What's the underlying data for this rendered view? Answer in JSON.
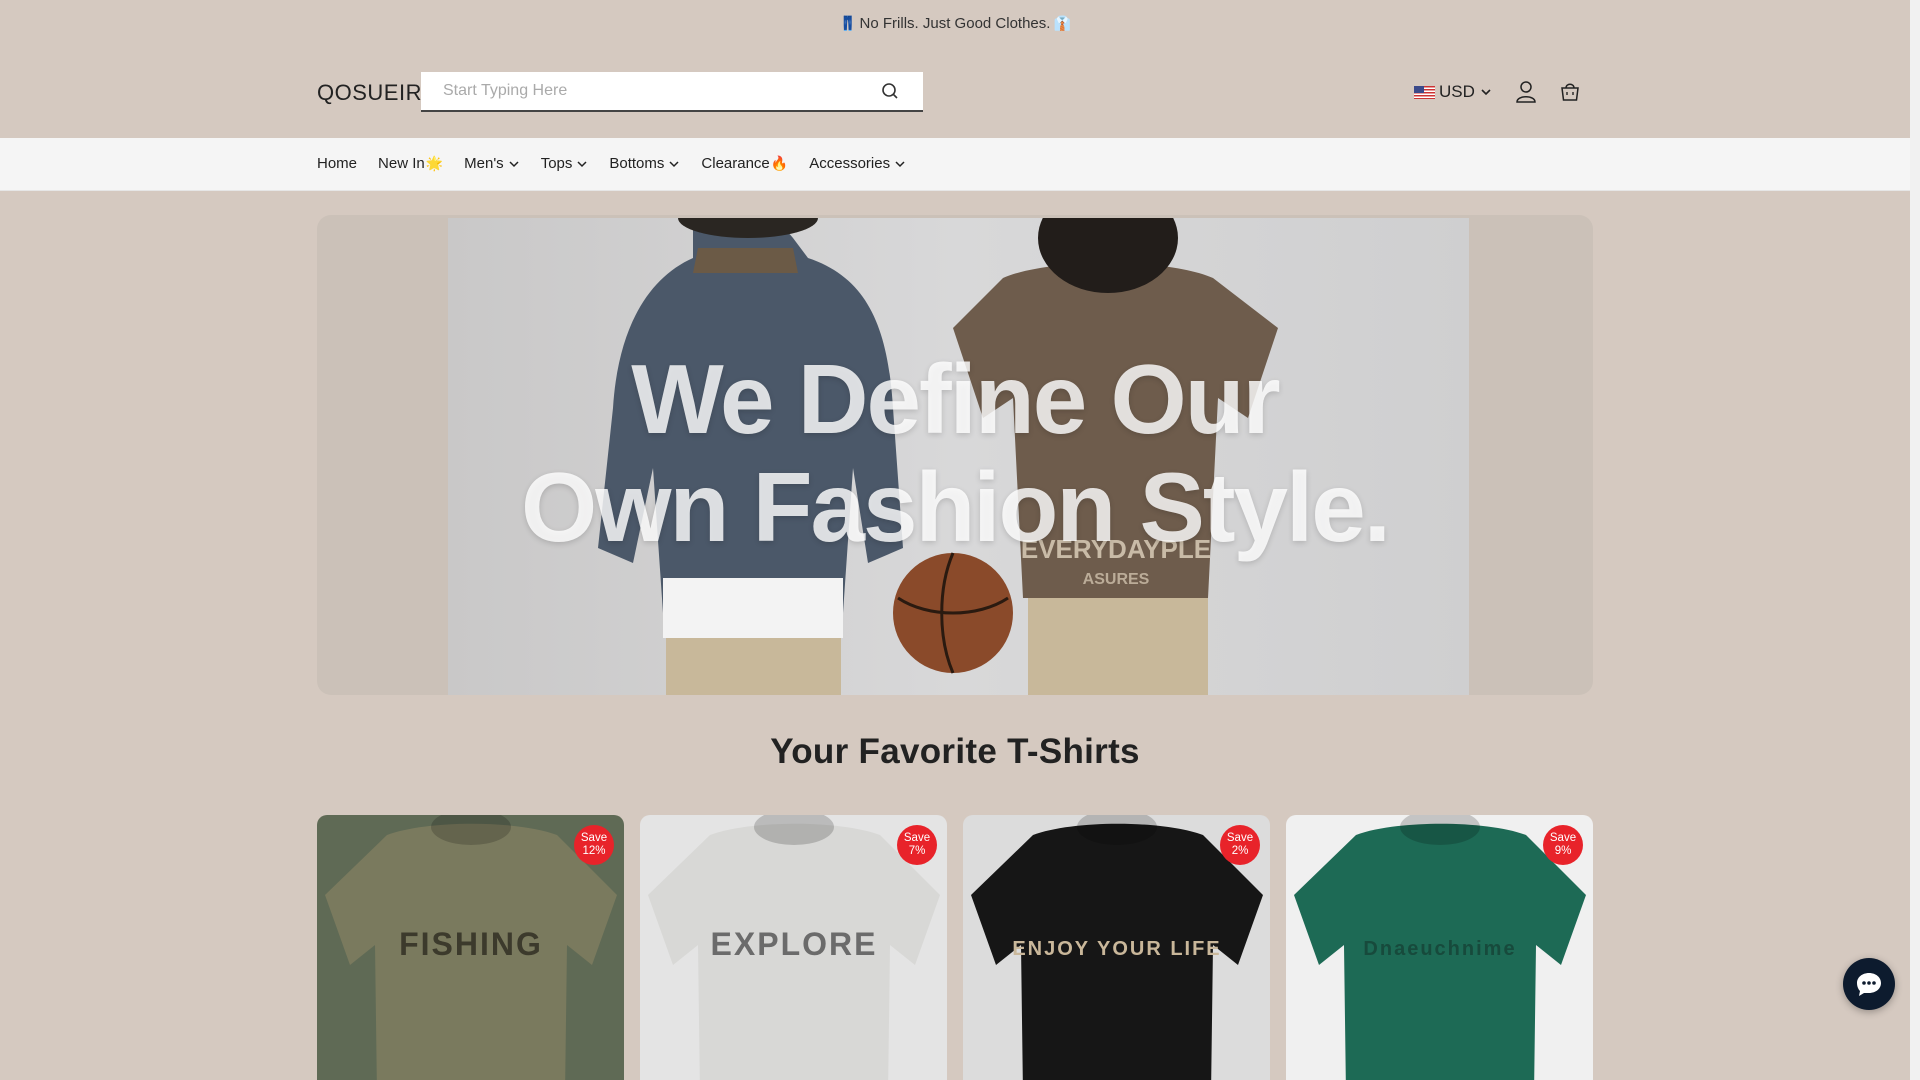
{
  "announcement": {
    "prefix_emoji": "👖",
    "text": "No Frills. Just Good Clothes.",
    "suffix_emoji": "👔"
  },
  "header": {
    "logo": "QOSUEIR",
    "search": {
      "placeholder": "Start Typing Here",
      "value": "",
      "icon": "search-icon"
    },
    "currency": {
      "label": "USD",
      "flag": "us-flag"
    },
    "icons": [
      "user-icon",
      "cart-icon"
    ]
  },
  "nav": {
    "items": [
      {
        "label": "Home",
        "suffix": "",
        "dropdown": false
      },
      {
        "label": "New In",
        "suffix": "🌟",
        "dropdown": false
      },
      {
        "label": "Men's",
        "suffix": "",
        "dropdown": true
      },
      {
        "label": "Tops",
        "suffix": "",
        "dropdown": true
      },
      {
        "label": "Bottoms",
        "suffix": "",
        "dropdown": true
      },
      {
        "label": "Clearance",
        "suffix": "🔥",
        "dropdown": false
      },
      {
        "label": "Accessories",
        "suffix": "",
        "dropdown": true
      }
    ]
  },
  "hero": {
    "line1": "We Define Our",
    "line2": "Own Fashion Style."
  },
  "section": {
    "title": "Your Favorite T-Shirts"
  },
  "products": [
    {
      "badge_top": "Save",
      "badge_bottom": "12%",
      "bg": "#5f6a55",
      "shirt": "#7a7a5e",
      "print": "FISHING",
      "print_color": "#3c3a2c"
    },
    {
      "badge_top": "Save",
      "badge_bottom": "7%",
      "bg": "#e4e4e4",
      "shirt": "#d8d8d6",
      "print": "EXPLORE",
      "print_color": "#6b6b6b"
    },
    {
      "badge_top": "Save",
      "badge_bottom": "2%",
      "bg": "#dcdcdc",
      "shirt": "#161616",
      "print": "ENJOY YOUR LIFE",
      "print_color": "#c9b79a"
    },
    {
      "badge_top": "Save",
      "badge_bottom": "9%",
      "bg": "#f0f0f0",
      "shirt": "#1d6a55",
      "print": "Dnaeuchnime",
      "print_color": "#174a3c"
    }
  ],
  "chat": {
    "icon": "chat-icon"
  }
}
